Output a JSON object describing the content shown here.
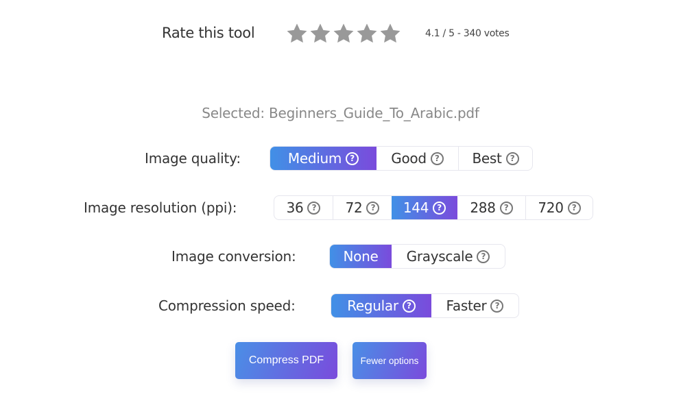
{
  "rating": {
    "label": "Rate this tool",
    "stars_total": 5,
    "star_color": "#999999",
    "summary": "4.1 / 5 - 340 votes"
  },
  "selected_file": {
    "text": "Selected: Beginners_Guide_To_Arabic.pdf"
  },
  "options": {
    "image_quality": {
      "label": "Image quality:",
      "choices": [
        {
          "label": "Medium",
          "help_icon": "question-circle-icon",
          "active": true
        },
        {
          "label": "Good",
          "help_icon": "question-circle-icon",
          "active": false
        },
        {
          "label": "Best",
          "help_icon": "question-circle-icon",
          "active": false
        }
      ]
    },
    "image_resolution": {
      "label": "Image resolution (ppi):",
      "choices": [
        {
          "label": "36",
          "help_icon": "question-circle-icon",
          "active": false
        },
        {
          "label": "72",
          "help_icon": "question-circle-icon",
          "active": false
        },
        {
          "label": "144",
          "help_icon": "question-circle-icon",
          "active": true
        },
        {
          "label": "288",
          "help_icon": "question-circle-icon",
          "active": false
        },
        {
          "label": "720",
          "help_icon": "question-circle-icon",
          "active": false
        }
      ]
    },
    "image_conversion": {
      "label": "Image conversion:",
      "choices": [
        {
          "label": "None",
          "active": true
        },
        {
          "label": "Grayscale",
          "help_icon": "question-circle-icon",
          "active": false
        }
      ]
    },
    "compression_speed": {
      "label": "Compression speed:",
      "choices": [
        {
          "label": "Regular",
          "help_icon": "question-circle-icon",
          "active": true
        },
        {
          "label": "Faster",
          "help_icon": "question-circle-icon",
          "active": false
        }
      ]
    }
  },
  "help_glyph": "?",
  "actions": {
    "compress_label": "Compress PDF",
    "fewer_options_label": "Fewer options"
  },
  "colors": {
    "accent_start": "#4190e6",
    "accent_end": "#7a4bdc"
  }
}
